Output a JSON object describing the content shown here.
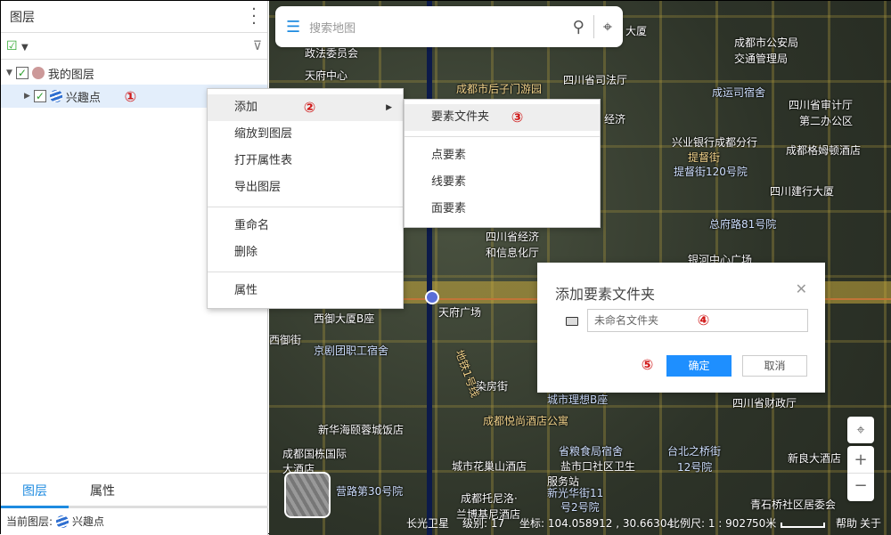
{
  "panel": {
    "title": "图层",
    "more_icon": "vertical-dots-icon",
    "tree": [
      {
        "label": "我的图层",
        "checked": true,
        "expanded": true
      },
      {
        "label": "兴趣点",
        "checked": true,
        "expanded": false,
        "badge": "①"
      }
    ],
    "tabs": [
      "图层",
      "属性"
    ],
    "current_layer_label": "当前图层:",
    "current_layer": "兴趣点"
  },
  "search": {
    "placeholder": "搜索地图"
  },
  "context_menu": {
    "items": [
      "添加",
      "缩放到图层",
      "打开属性表",
      "导出图层",
      "重命名",
      "删除",
      "属性"
    ],
    "badge": "②"
  },
  "submenu": {
    "items": [
      "要素文件夹",
      "点要素",
      "线要素",
      "面要素"
    ],
    "badge": "③"
  },
  "dialog": {
    "title": "添加要素文件夹",
    "input_placeholder": "未命名文件夹",
    "input_badge": "④",
    "ok": "确定",
    "cancel": "取消",
    "ok_badge": "⑤",
    "accent": "#1e8fff"
  },
  "map": {
    "labels": [
      "天府中心",
      "政法委员会",
      "成都市后子门游园",
      "四川省司法厅",
      "大厦",
      "成都市公安局",
      "交通管理局",
      "成运司宿舍",
      "四川省审计厅",
      "第二办公区",
      "兴业银行成都分行",
      "成都格姆顿酒店",
      "提督街",
      "提督街120号院",
      "四川建行大厦",
      "总府路81号院",
      "四川省经济",
      "和信息化厅",
      "银河中心广场",
      "天府广场",
      "西御大厦B座",
      "西御街",
      "京剧团职工宿舍",
      "地铁1号线",
      "染房街",
      "城市理想B座",
      "四川省财政厅",
      "成都悦尚酒店公寓",
      "新华海颐蓉城饭店",
      "成都国栋国际",
      "大酒店",
      "城市花巢山酒店",
      "盐市口社区卫生",
      "服务站",
      "新光华街11",
      "号2号院",
      "成都托尼洛·",
      "兰博基尼酒店",
      "新良大酒店",
      "青石桥社区居委会",
      "12号院",
      "台北之桥街",
      "省粮食局宿舍",
      "营路第30号院",
      "经济"
    ]
  },
  "status": {
    "source": "长光卫星",
    "level": "级别: 17",
    "coords": "坐标: 104.058912 , 30.66304",
    "scale": "比例尺: 1 : 9027",
    "scale_bar": "50米",
    "help": "帮助",
    "about": "关于"
  }
}
